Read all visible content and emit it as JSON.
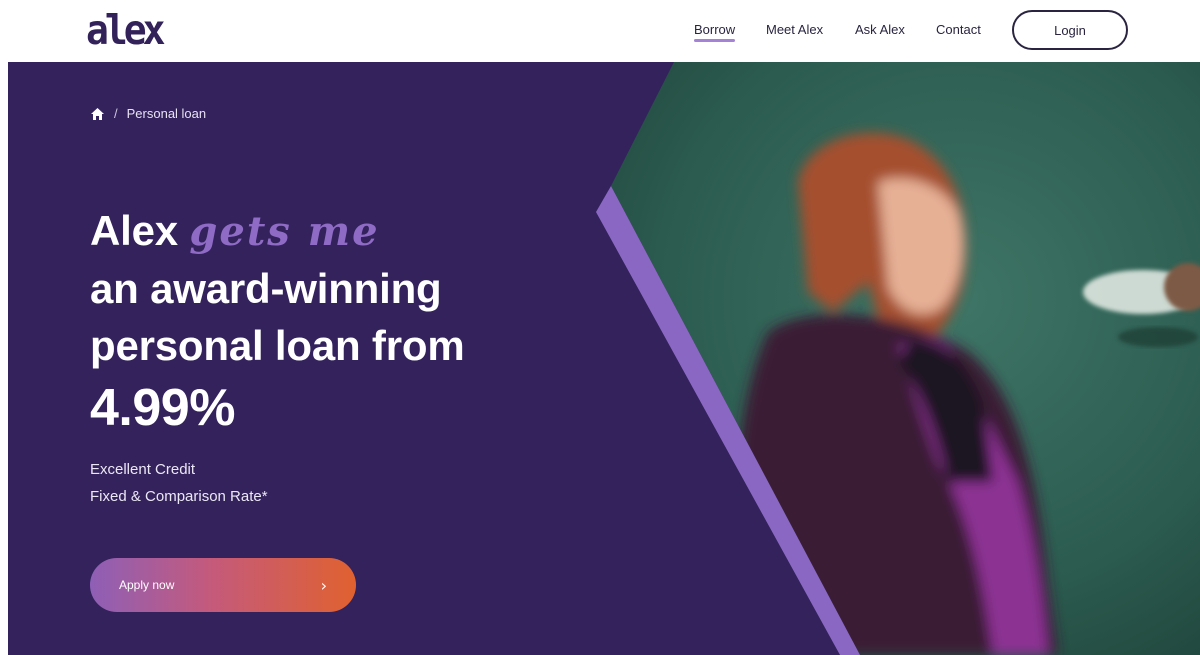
{
  "brand": {
    "logo_text": "alex"
  },
  "nav": {
    "items": [
      {
        "label": "Borrow",
        "active": true
      },
      {
        "label": "Meet Alex",
        "active": false
      },
      {
        "label": "Ask Alex",
        "active": false
      },
      {
        "label": "Contact",
        "active": false
      }
    ],
    "login_label": "Login"
  },
  "breadcrumb": {
    "separator": "/",
    "current": "Personal loan",
    "home_icon": "home-icon"
  },
  "hero": {
    "headline_start": "Alex",
    "headline_script": "gets me",
    "headline_line2": "an award-winning",
    "headline_line3": "personal loan from",
    "rate": "4.99%",
    "rate_desc_line1": "Excellent Credit",
    "rate_desc_line2": "Fixed & Comparison Rate*",
    "cta_label": "Apply now",
    "cta_icon": "chevron-right-icon"
  },
  "colors": {
    "brand_purple": "#33225c",
    "accent_lavender": "#8f6bc6",
    "cta_gradient_start": "#8e5fb7",
    "cta_gradient_end": "#e0612f",
    "text_dark": "#2a2440"
  }
}
